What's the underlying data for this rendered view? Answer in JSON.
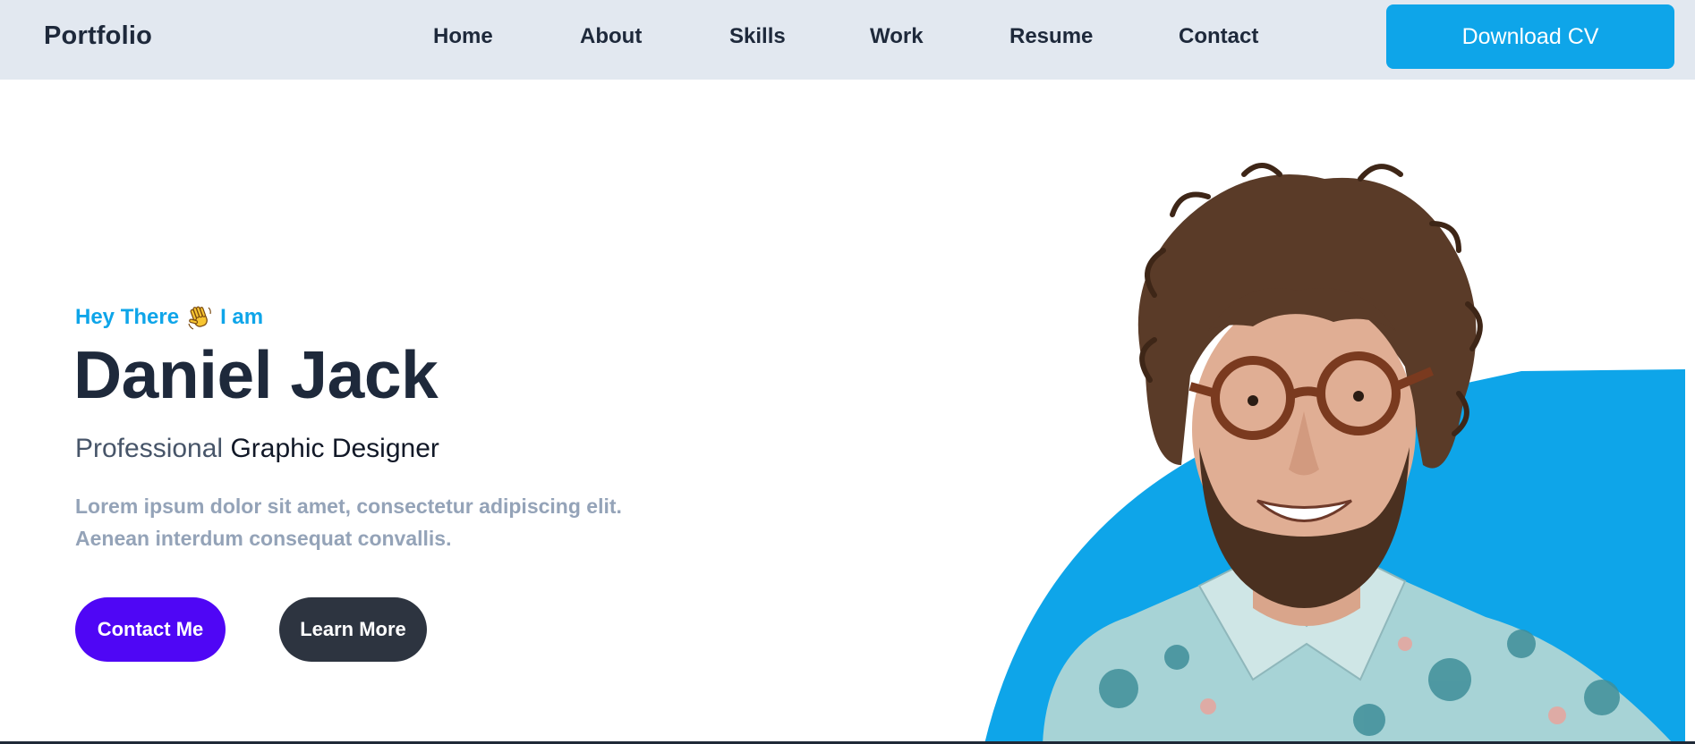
{
  "navbar": {
    "brand": "Portfolio",
    "links": [
      "Home",
      "About",
      "Skills",
      "Work",
      "Resume",
      "Contact"
    ],
    "download_label": "Download CV"
  },
  "hero": {
    "greeting_before": "Hey There",
    "greeting_icon": "waving-hand-icon",
    "greeting_after": "I am",
    "name": "Daniel Jack",
    "subtitle_light": "Professional",
    "subtitle_dark": "Graphic Designer",
    "description_line1": "Lorem ipsum dolor sit amet, consectetur adipiscing elit.",
    "description_line2": "Aenean interdum consequat convallis.",
    "contact_button": "Contact Me",
    "learn_button": "Learn More"
  },
  "colors": {
    "accent": "#0ea5e9",
    "primary_button": "#4f06f5",
    "secondary_button": "#2d3440",
    "navbar_bg": "#e2e8f0",
    "heading": "#1e293b",
    "muted_text": "#94a3b8"
  }
}
